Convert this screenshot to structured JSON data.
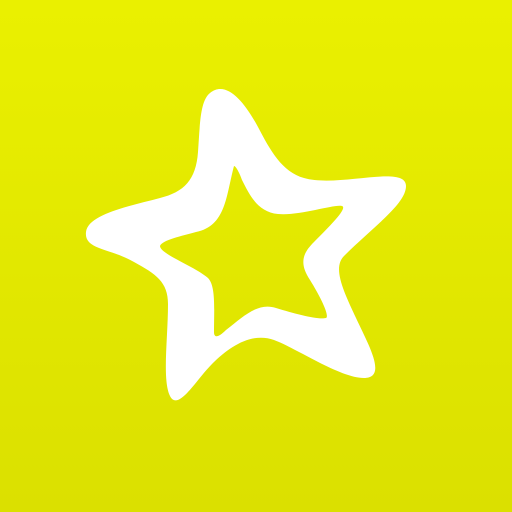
{
  "icon": {
    "name": "star-icon",
    "background_top": "#EAF000",
    "background_bottom": "#DBE000",
    "background_color": "#E2E800",
    "star_color": "#FFFFFF"
  }
}
